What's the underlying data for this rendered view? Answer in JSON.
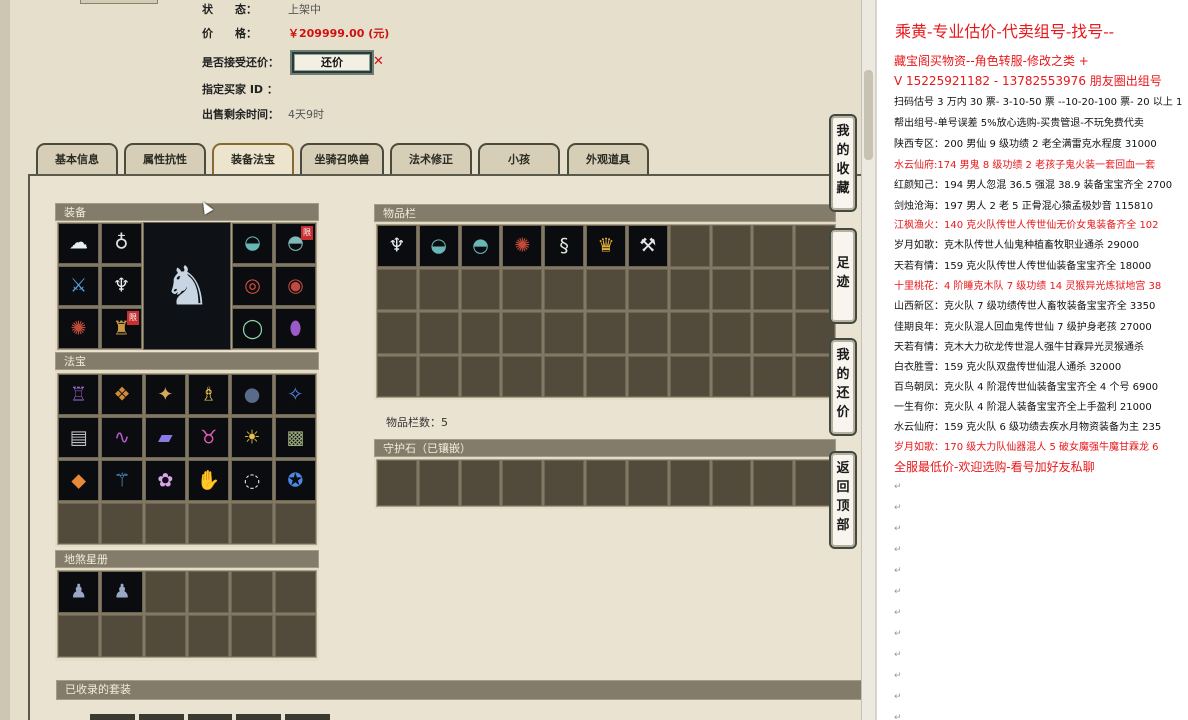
{
  "status": {
    "status_label": "状　　态：",
    "status_value": "上架中",
    "price_label": "价　　格：",
    "price_value": "￥209999.00 (元)",
    "counter_label": "是否接受还价：",
    "counter_button": "还价",
    "buyer_label": "指定买家 ID ：",
    "time_label": "出售剩余时间：",
    "time_value": "4天9时"
  },
  "tabs": [
    "基本信息",
    "属性抗性",
    "装备法宝",
    "坐骑召唤兽",
    "法术修正",
    "小孩",
    "外观道具"
  ],
  "active_tab": "装备法宝",
  "panels": {
    "equipment": "装备",
    "fabao": "法宝",
    "dishaxing": "地煞星册",
    "inventory": "物品栏",
    "inventory_count": "物品栏数：5",
    "guard_stone": "守护石（已镶嵌）",
    "suits": "已收录的套装"
  },
  "equip_badges": [
    "限",
    "限"
  ],
  "side_buttons": [
    "我的收藏",
    "足迹",
    "我的还价",
    "返回顶部"
  ],
  "doc": {
    "title": "乘黄-专业估价-代卖组号-找号--",
    "lines": [
      {
        "text": "藏宝阁买物资--角色转服-修改之类 +",
        "color": "red",
        "size": "big"
      },
      {
        "text": "V 15225921182 - 13782553976 朋友圈出组号",
        "color": "red",
        "size": "big"
      },
      {
        "text": "扫码估号 3 万内 30 票- 3-10-50 票 --10-20-100 票- 20 以上 1",
        "color": "black",
        "size": "normal"
      },
      {
        "text": "帮出组号-单号误差 5%放心选购-买贵管退-不玩免费代卖",
        "color": "black",
        "size": "normal"
      },
      {
        "text": "陕西专区：200 男仙 9 级功绩 2 老全满雷克水程度 31000",
        "color": "black",
        "size": "normal"
      },
      {
        "text": "水云仙府:174 男鬼 8 级功绩 2 老孩子鬼火装一套回血一套",
        "color": "red",
        "size": "normal"
      },
      {
        "text": "红颜知己：194 男人忽混 36.5 强混 38.9 装备宝宝齐全 2700",
        "color": "black",
        "size": "normal"
      },
      {
        "text": "剑烛沧海：197 男人 2 老 5 正骨混心猿孟极妙音 115810",
        "color": "black",
        "size": "normal"
      },
      {
        "text": "江枫渔火：140 克火队传世人传世仙无价女鬼装备齐全 102",
        "color": "red",
        "size": "normal"
      },
      {
        "text": "岁月如歌：克木队传世人仙鬼种植畜牧职业通杀 29000",
        "color": "black",
        "size": "normal"
      },
      {
        "text": "天若有情：159 克火队传世人传世仙装备宝宝齐全 18000",
        "color": "black",
        "size": "normal"
      },
      {
        "text": "十里桃花：4 阶睡克木队 7 级功绩 14 灵猴异光炼狱地宫 38",
        "color": "red",
        "size": "normal"
      },
      {
        "text": "山西新区：克火队 7 级功绩传世人畜牧装备宝宝齐全 3350",
        "color": "black",
        "size": "normal"
      },
      {
        "text": "佳期良年：克火队混人回血鬼传世仙 7 级护身老孩 27000",
        "color": "black",
        "size": "normal"
      },
      {
        "text": "天若有情：克木大力砍龙传世混人强牛甘霖异光灵猴通杀",
        "color": "black",
        "size": "normal"
      },
      {
        "text": "白衣胜雪：159 克火队双盘传世仙混人通杀 32000",
        "color": "black",
        "size": "normal"
      },
      {
        "text": "百鸟朝凤：克火队 4 阶混传世仙装备宝宝齐全 4 个号 6900",
        "color": "black",
        "size": "normal"
      },
      {
        "text": "一生有你：克火队 4 阶混人装备宝宝齐全上手盈利 21000",
        "color": "black",
        "size": "normal"
      },
      {
        "text": "水云仙府：159 克火队 6 级功绩去疾水月物资装备为主 235",
        "color": "black",
        "size": "normal"
      },
      {
        "text": "岁月如歌：170 级大力队仙器混人 5 破女魔强牛魔甘霖龙 6",
        "color": "red",
        "size": "normal"
      },
      {
        "text": "全服最低价-欢迎选购-看号加好友私聊",
        "color": "red",
        "size": "big"
      }
    ]
  }
}
